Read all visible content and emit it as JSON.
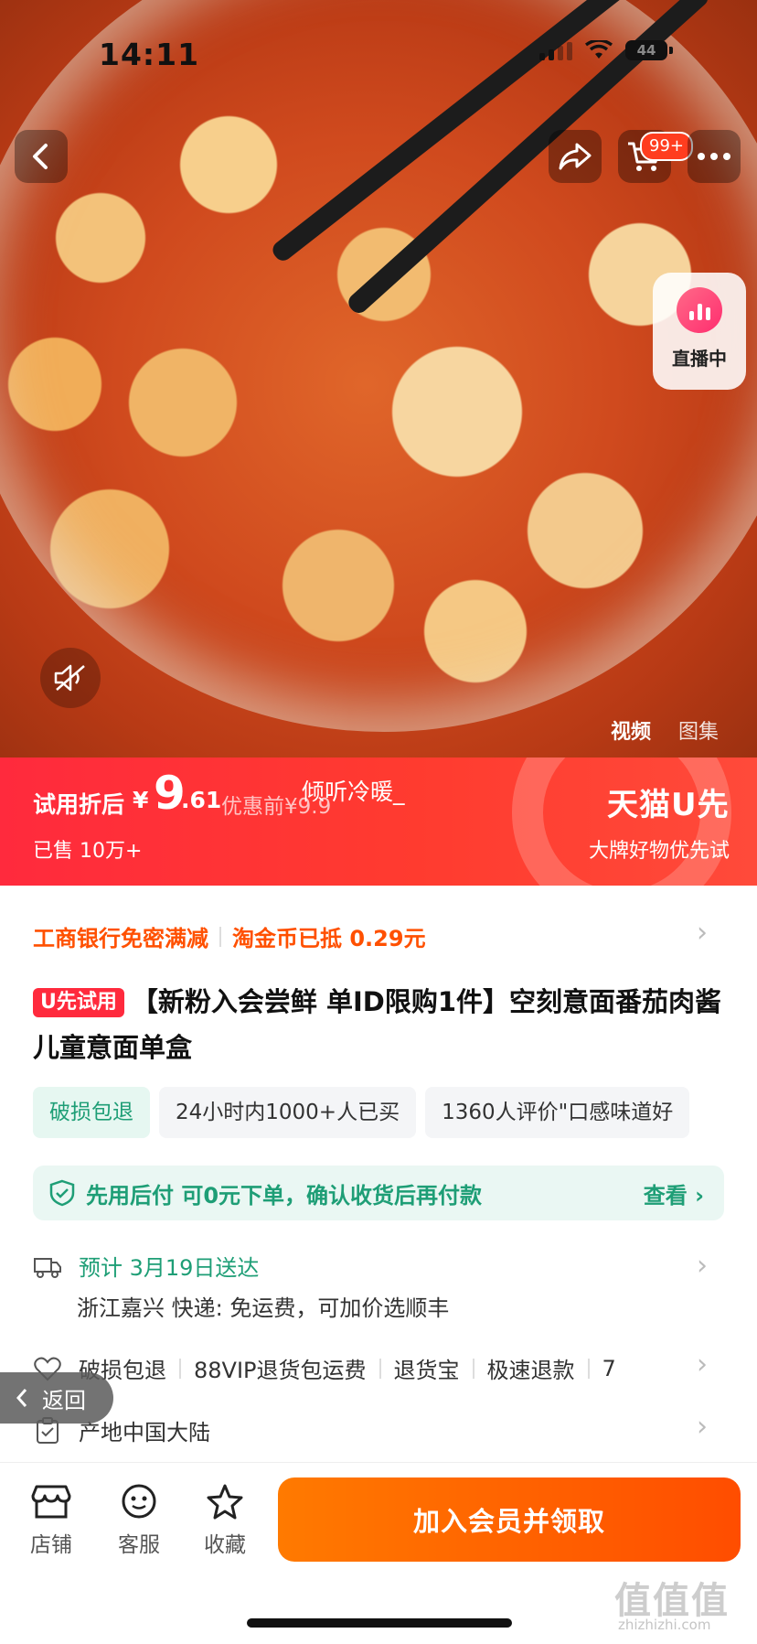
{
  "status_bar": {
    "time": "14:11",
    "battery": "44"
  },
  "header": {
    "cart_badge": "99+"
  },
  "live": {
    "label": "直播中"
  },
  "media_tabs": {
    "video": "视频",
    "gallery": "图集"
  },
  "banner": {
    "price_label": "试用折后",
    "currency": "¥",
    "price_int": "9",
    "price_dec": ".61",
    "price_before": "优惠前¥9.9",
    "overlay_user": "倾听冷暖_",
    "sold": "已售 10万+",
    "brand": "天猫U先",
    "brand_slogan": "大牌好物优先试"
  },
  "coupons": {
    "bank": "工商银行免密满减",
    "coin": "淘金币已抵 0.29元"
  },
  "product": {
    "tag": "U先试用",
    "title": "【新粉入会尝鲜 单ID限购1件】空刻意面番茄肉酱儿童意面单盒"
  },
  "chips": [
    "破损包退",
    "24小时内1000+人已买",
    "1360人评价\"口感味道好"
  ],
  "bnpl": {
    "text": "先用后付 可0元下单，确认收货后再付款",
    "link": "查看 ›"
  },
  "delivery": {
    "estimate": "预计 3月19日送达",
    "detail": "浙江嘉兴  快递: 免运费，可加价选顺丰"
  },
  "services": [
    "破损包退",
    "88VIP退货包运费",
    "退货宝",
    "极速退款",
    "7"
  ],
  "origin": "产地中国大陆",
  "back_float": "返回",
  "bottom_bar": {
    "store": "店铺",
    "service": "客服",
    "favorite": "收藏",
    "cta": "加入会员并领取"
  },
  "watermark": {
    "site": "值值值",
    "url": "zhizhizhi.com"
  },
  "colors": {
    "accent_red": "#ff2a3d",
    "accent_orange": "#ff5000",
    "green": "#1e9e76"
  }
}
